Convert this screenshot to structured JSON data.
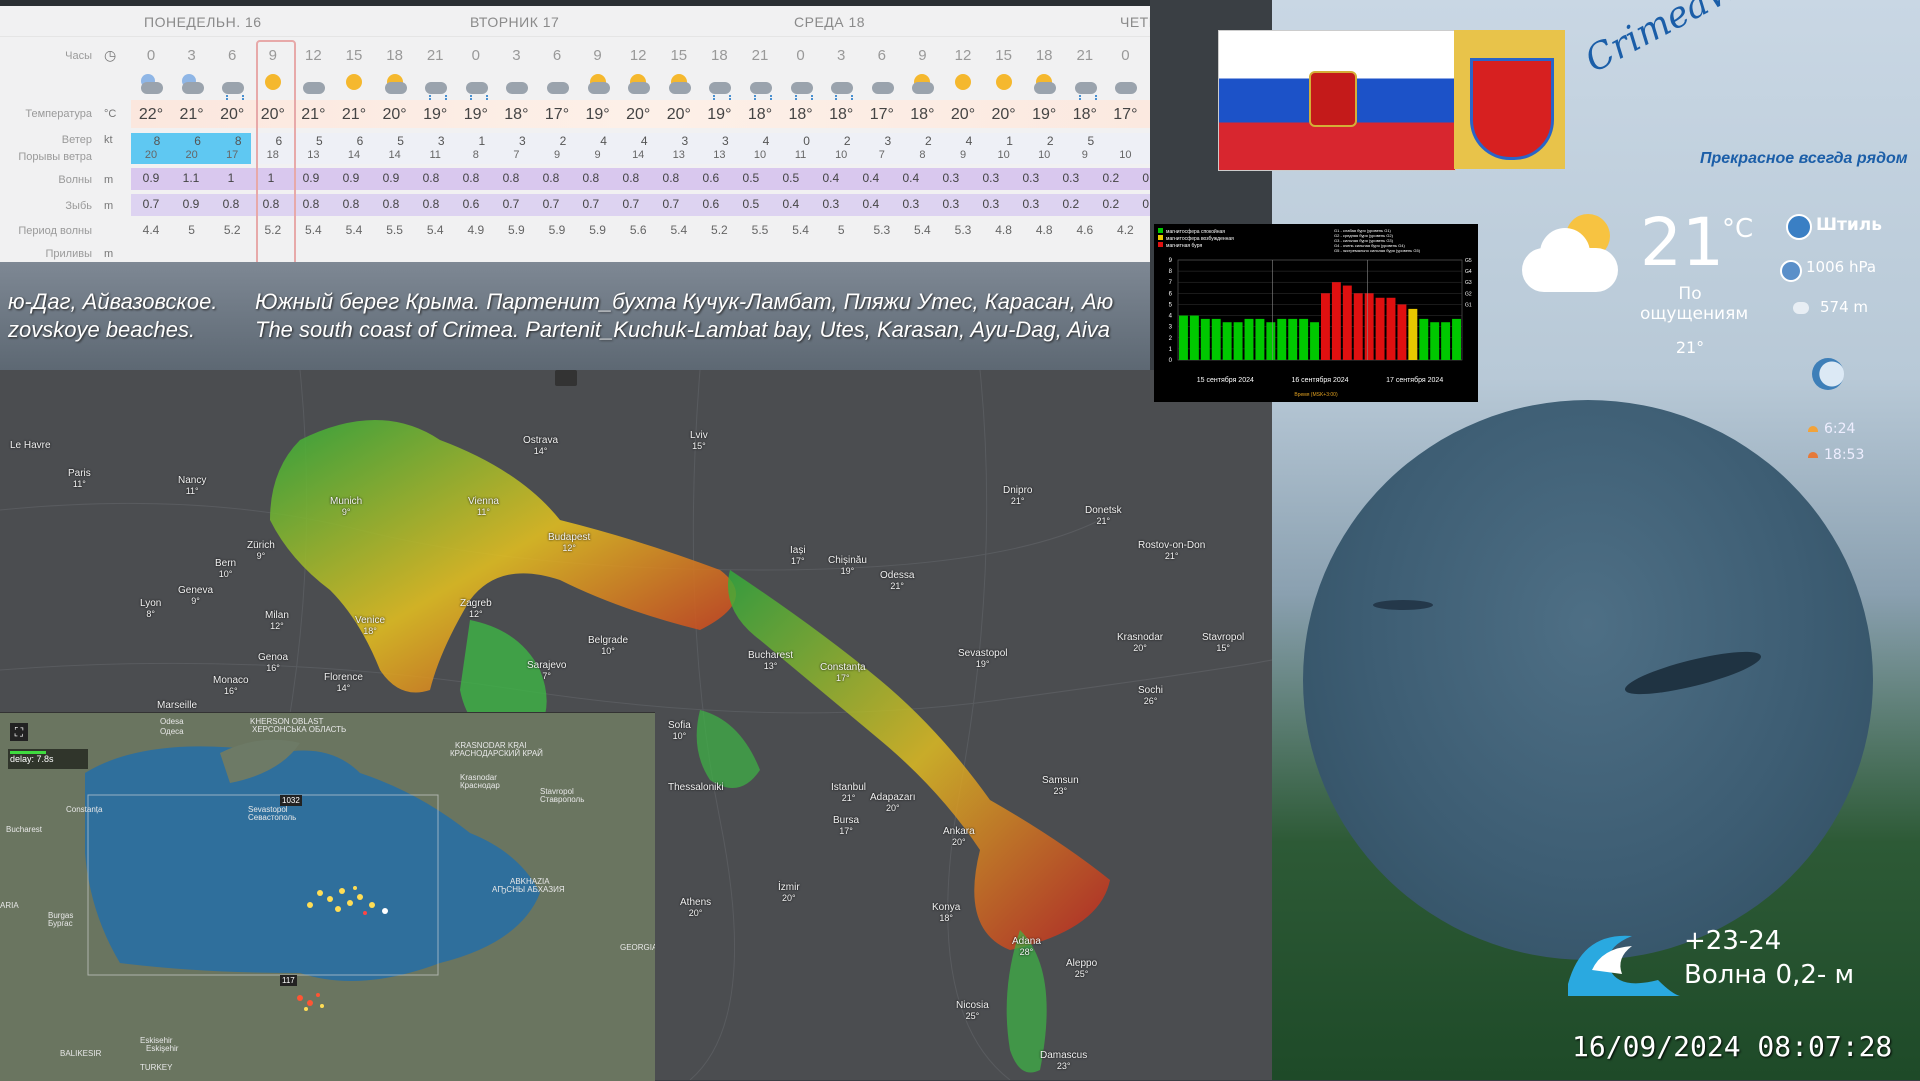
{
  "forecast": {
    "days": [
      {
        "label": "ПОНЕДЕЛЬН. 16"
      },
      {
        "label": "ВТОРНИК 17"
      },
      {
        "label": "СРЕДА 18"
      },
      {
        "label": "ЧЕТЕ"
      }
    ],
    "row_labels": {
      "hours": "Часы",
      "temperature": "Температура",
      "wind": "Ветер",
      "gusts": "Порывы ветра",
      "waves": "Волны",
      "swell": "Зыбь",
      "period": "Период волны",
      "tides": "Приливы"
    },
    "units": {
      "temperature": "°C",
      "wind": "kt",
      "waves": "m",
      "swell": "m",
      "tides": "m"
    },
    "hours": [
      "0",
      "3",
      "6",
      "9",
      "12",
      "15",
      "18",
      "21",
      "0",
      "3",
      "6",
      "9",
      "12",
      "15",
      "18",
      "21",
      "0",
      "3",
      "6",
      "9",
      "12",
      "15",
      "18",
      "21",
      "0"
    ],
    "weather_icons": [
      "moon-cloud",
      "moon-cloud",
      "cloud-rain",
      "sun",
      "cloud",
      "sun",
      "sun-cloud",
      "cloud-rain",
      "cloud-rain",
      "cloud",
      "cloud",
      "sun-cloud",
      "sun-cloud",
      "sun-cloud",
      "cloud-rain",
      "cloud-rain",
      "cloud-rain",
      "cloud-rain",
      "cloud",
      "sun-cloud",
      "sun",
      "sun",
      "sun-cloud",
      "cloud-rain",
      "cloud"
    ],
    "temperatures": [
      "22°",
      "21°",
      "20°",
      "20°",
      "21°",
      "21°",
      "20°",
      "19°",
      "19°",
      "18°",
      "17°",
      "19°",
      "20°",
      "20°",
      "19°",
      "18°",
      "18°",
      "18°",
      "17°",
      "18°",
      "20°",
      "20°",
      "19°",
      "18°",
      "17°"
    ],
    "wind": [
      "8",
      "6",
      "8",
      "6",
      "5",
      "6",
      "5",
      "3",
      "1",
      "3",
      "2",
      "4",
      "4",
      "3",
      "3",
      "4",
      "0",
      "2",
      "3",
      "2",
      "4",
      "1",
      "2",
      "5"
    ],
    "gusts": [
      "20",
      "20",
      "17",
      "18",
      "13",
      "14",
      "14",
      "11",
      "8",
      "7",
      "9",
      "9",
      "14",
      "13",
      "13",
      "10",
      "11",
      "10",
      "7",
      "8",
      "9",
      "10",
      "10",
      "9",
      "10"
    ],
    "waves": [
      "0.9",
      "1.1",
      "1",
      "1",
      "0.9",
      "0.9",
      "0.9",
      "0.8",
      "0.8",
      "0.8",
      "0.8",
      "0.8",
      "0.8",
      "0.8",
      "0.6",
      "0.5",
      "0.5",
      "0.4",
      "0.4",
      "0.4",
      "0.3",
      "0.3",
      "0.3",
      "0.3",
      "0.2",
      "0.2"
    ],
    "swell": [
      "0.7",
      "0.9",
      "0.8",
      "0.8",
      "0.8",
      "0.8",
      "0.8",
      "0.8",
      "0.6",
      "0.7",
      "0.7",
      "0.7",
      "0.7",
      "0.7",
      "0.6",
      "0.5",
      "0.4",
      "0.3",
      "0.4",
      "0.3",
      "0.3",
      "0.3",
      "0.3",
      "0.2",
      "0.2",
      "0.2"
    ],
    "period": [
      "4.4",
      "5",
      "5.2",
      "5.2",
      "5.4",
      "5.4",
      "5.5",
      "5.4",
      "4.9",
      "5.9",
      "5.9",
      "5.9",
      "5.6",
      "5.4",
      "5.2",
      "5.5",
      "5.4",
      "5",
      "5.3",
      "5.4",
      "5.3",
      "4.8",
      "4.8",
      "4.6",
      "4.2"
    ]
  },
  "ticker": {
    "line1_left": "ю-Даг, Айвазовское.",
    "line1_right": "Южный берег Крыма. Партенит_бухта Кучук-Ламбат, Пляжи Утес,    Карасан, Аю",
    "line2_left": "zovskoye beaches.",
    "line2_right": "The south coast of Crimea. Partenit_Kuchuk-Lambat bay, Utes, Karasan, Ayu-Dag, Aiva"
  },
  "radar_cities": [
    {
      "name": "Le Havre",
      "temp": ""
    },
    {
      "name": "Paris",
      "temp": "11°"
    },
    {
      "name": "Nancy",
      "temp": "11°"
    },
    {
      "name": "Munich",
      "temp": "9°"
    },
    {
      "name": "Vienna",
      "temp": "11°"
    },
    {
      "name": "Ostrava",
      "temp": "14°"
    },
    {
      "name": "Lviv",
      "temp": "15°"
    },
    {
      "name": "Dnipro",
      "temp": "21°"
    },
    {
      "name": "Donetsk",
      "temp": "21°"
    },
    {
      "name": "Rostov-on-Don",
      "temp": "21°"
    },
    {
      "name": "Zürich",
      "temp": "9°"
    },
    {
      "name": "Bern",
      "temp": "10°"
    },
    {
      "name": "Budapest",
      "temp": "12°"
    },
    {
      "name": "Iași",
      "temp": "17°"
    },
    {
      "name": "Chișinău",
      "temp": "19°"
    },
    {
      "name": "Odessa",
      "temp": "21°"
    },
    {
      "name": "Geneva",
      "temp": "9°"
    },
    {
      "name": "Lyon",
      "temp": "8°"
    },
    {
      "name": "Milan",
      "temp": "12°"
    },
    {
      "name": "Venice",
      "temp": "18°"
    },
    {
      "name": "Zagreb",
      "temp": "12°"
    },
    {
      "name": "Belgrade",
      "temp": "10°"
    },
    {
      "name": "Sarajevo",
      "temp": "7°"
    },
    {
      "name": "Bucharest",
      "temp": "13°"
    },
    {
      "name": "Constanța",
      "temp": "17°"
    },
    {
      "name": "Sevastopol",
      "temp": "19°"
    },
    {
      "name": "Krasnodar",
      "temp": "20°"
    },
    {
      "name": "Stavropol",
      "temp": "15°"
    },
    {
      "name": "Genoa",
      "temp": "16°"
    },
    {
      "name": "Monaco",
      "temp": "16°"
    },
    {
      "name": "Marseille",
      "temp": ""
    },
    {
      "name": "Florence",
      "temp": "14°"
    },
    {
      "name": "Sochi",
      "temp": "26°"
    },
    {
      "name": "Sofia",
      "temp": "10°"
    },
    {
      "name": "Samsun",
      "temp": "23°"
    },
    {
      "name": "Istanbul",
      "temp": "21°"
    },
    {
      "name": "Adapazarı",
      "temp": "20°"
    },
    {
      "name": "Bursa",
      "temp": "17°"
    },
    {
      "name": "Ankara",
      "temp": "20°"
    },
    {
      "name": "İzmir",
      "temp": "20°"
    },
    {
      "name": "Athens",
      "temp": "20°"
    },
    {
      "name": "Konya",
      "temp": "18°"
    },
    {
      "name": "Adana",
      "temp": "28°"
    },
    {
      "name": "Aleppo",
      "temp": "25°"
    },
    {
      "name": "Nicosia",
      "temp": "25°"
    },
    {
      "name": "Damascus",
      "temp": "23°"
    },
    {
      "name": "Thessaloniki",
      "temp": ""
    }
  ],
  "lightning": {
    "delay": "delay: 7.8s",
    "marker1": "1032",
    "marker2": "117",
    "labels": [
      "Odesa",
      "Одеса",
      "KHERSON OBLAST",
      "ХЕРСОНСЬКА ОБЛАСТЬ",
      "KRASNODAR KRAI",
      "КРАСНОДАРСКИЙ КРАЙ",
      "Sevastopol",
      "Севастополь",
      "Krasnodar",
      "Краснодар",
      "Stavropol",
      "Ставрополь",
      "ABKHAZIA",
      "АҦСНЫ АБХАЗИЯ",
      "GEORGIA",
      "Bucharest",
      "Constanța",
      "Burgas",
      "Бургас",
      "Eskisehir",
      "Eskişehir",
      "BALIKESIR",
      "TURKEY",
      "ARIA"
    ]
  },
  "kp_chart": {
    "legend_left": [
      "магнитосфера спокойная",
      "магнитосфера возбужденная",
      "магнитная буря"
    ],
    "legend_right": [
      "G1 - слабая буря (уровень G1)",
      "G2 - средняя буря (уровень G2)",
      "G3 - сильная буря (уровень G3)",
      "G4 - очень сильная буря (уровень G4)",
      "G5 - экстремально сильная буря (уровень G5)"
    ],
    "y_ticks": [
      "9",
      "8",
      "7",
      "6",
      "5",
      "4",
      "3",
      "2",
      "1",
      "0"
    ],
    "g_ticks": [
      "G5",
      "G4",
      "G3",
      "G2",
      "G1"
    ],
    "dates": [
      "15 сентября 2024",
      "16 сентября 2024",
      "17 сентября 2024"
    ],
    "footer": "Время (MSK+3:00)",
    "values": [
      4,
      4,
      3.7,
      3.7,
      3.4,
      3.4,
      3.7,
      3.7,
      3.4,
      3.7,
      3.7,
      3.7,
      3.4,
      6,
      7,
      6.7,
      6,
      6,
      5.6,
      5.6,
      5,
      4.6,
      3.7,
      3.4,
      3.4,
      3.7
    ],
    "colors": {
      "calm": "#00c800",
      "excited": "#e8c800",
      "storm": "#e01010"
    }
  },
  "brand": {
    "name": "CrimeaWonderland",
    "slogan": "Прекрасное всегда рядом"
  },
  "weather_now": {
    "temp": "21",
    "unit": "°C",
    "feels_label": "По ощущениям",
    "feels_value": "21°",
    "wind": "Штиль",
    "pressure": "1006 hPa",
    "visibility": "574 m",
    "sunrise": "6:24",
    "sunset": "18:53"
  },
  "sea": {
    "water_temp": "+23-24",
    "wave": "Волна  0,2- м"
  },
  "timestamp": "16/09/2024 08:07:28"
}
